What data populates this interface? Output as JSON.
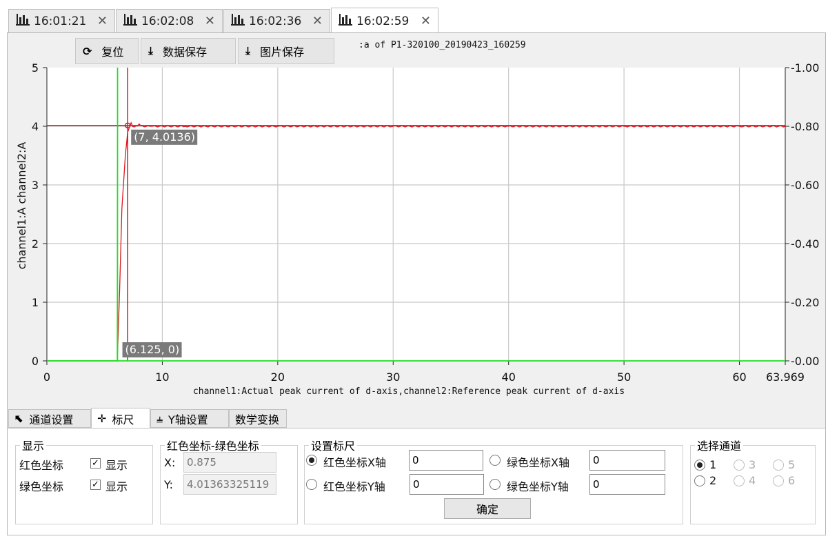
{
  "tabs": [
    {
      "label": "16:01:21",
      "icon": "bar-chart-icon",
      "active": false
    },
    {
      "label": "16:02:08",
      "icon": "bar-chart-icon",
      "active": false
    },
    {
      "label": "16:02:36",
      "icon": "bar-chart-icon",
      "active": false
    },
    {
      "label": "16:02:59",
      "icon": "bar-chart-icon",
      "active": true
    }
  ],
  "toolbar": {
    "reset_label": "复位",
    "save_data_label": "数据保存",
    "save_image_label": "图片保存"
  },
  "chart": {
    "title": ":a of P1-320100_20190423_160259",
    "ylabel_left": "channel1:A channel2:A",
    "xlabel": "channel1:Actual peak current of d-axis,channel2:Reference peak current of d-axis",
    "red_cursor_label": "(7, 4.0136)",
    "green_cursor_label": "(6.125, 0)",
    "colors": {
      "red": "#e0141e",
      "green": "#22dd22",
      "grid": "#c8c8c8"
    }
  },
  "chart_data": {
    "type": "line",
    "x_range": [
      0,
      63.969
    ],
    "y_left_range": [
      0,
      5
    ],
    "y_right_range": [
      0,
      1.0
    ],
    "x_ticks": [
      "0",
      "10",
      "20",
      "30",
      "40",
      "50",
      "60",
      "63.969"
    ],
    "x_tick_values": [
      0,
      10,
      20,
      30,
      40,
      50,
      60,
      63.969
    ],
    "y_left_ticks": [
      "0",
      "1",
      "2",
      "3",
      "4",
      "5"
    ],
    "y_left_tick_values": [
      0,
      1,
      2,
      3,
      4,
      5
    ],
    "y_right_ticks": [
      "0.00",
      "0.20",
      "0.40",
      "0.60",
      "0.80",
      "1.00"
    ],
    "y_right_tick_values": [
      0,
      0.2,
      0.4,
      0.6,
      0.8,
      1.0
    ],
    "grid": true,
    "series": [
      {
        "color": "#e0141e",
        "points": [
          [
            0,
            0
          ],
          [
            6.1,
            0
          ],
          [
            6.3,
            1.2
          ],
          [
            6.5,
            2.6
          ],
          [
            6.8,
            3.5
          ],
          [
            7,
            3.9
          ],
          [
            7.3,
            4.06
          ],
          [
            8,
            4.04
          ],
          [
            9,
            4.0
          ],
          [
            12,
            4.0
          ],
          [
            20,
            4.0
          ],
          [
            30,
            4.0
          ],
          [
            40,
            4.0
          ],
          [
            50,
            4.0
          ],
          [
            60,
            4.0
          ],
          [
            63.969,
            4.0
          ]
        ]
      },
      {
        "color": "#22dd22",
        "points": [
          [
            0,
            0
          ],
          [
            6.1,
            0
          ],
          [
            6.125,
            4.0
          ],
          [
            6.125,
            5.0
          ]
        ]
      }
    ],
    "cursors": {
      "red": {
        "x": 7,
        "y": 4.0136
      },
      "green": {
        "x": 6.125,
        "y": 0
      }
    }
  },
  "panel_tabs": [
    {
      "label": "通道设置",
      "icon": "cursor-pointer-icon",
      "active": false
    },
    {
      "label": "标尺",
      "icon": "crosshair-icon",
      "active": true
    },
    {
      "label": "Y轴设置",
      "icon": "axis-icon",
      "active": false
    },
    {
      "label": "数学变换",
      "icon": "",
      "active": false
    }
  ],
  "display_group": {
    "legend": "显示",
    "red_label": "红色坐标",
    "green_label": "绿色坐标",
    "show_label": "显示",
    "red_checked": true,
    "green_checked": true
  },
  "coord_group": {
    "legend": "红色坐标-绿色坐标",
    "x_label": "X:",
    "y_label": "Y:",
    "x_value": "0.875",
    "y_value": "4.01363325119"
  },
  "ruler_group": {
    "legend": "设置标尺",
    "red_x_label": "红色坐标X轴",
    "red_y_label": "红色坐标Y轴",
    "green_x_label": "绿色坐标X轴",
    "green_y_label": "绿色坐标Y轴",
    "red_x_value": "0",
    "red_y_value": "0",
    "green_x_value": "0",
    "green_y_value": "0",
    "confirm_label": "确定"
  },
  "channel_group": {
    "legend": "选择通道",
    "options": [
      "1",
      "2",
      "3",
      "4",
      "5",
      "6"
    ],
    "selected": "1"
  }
}
